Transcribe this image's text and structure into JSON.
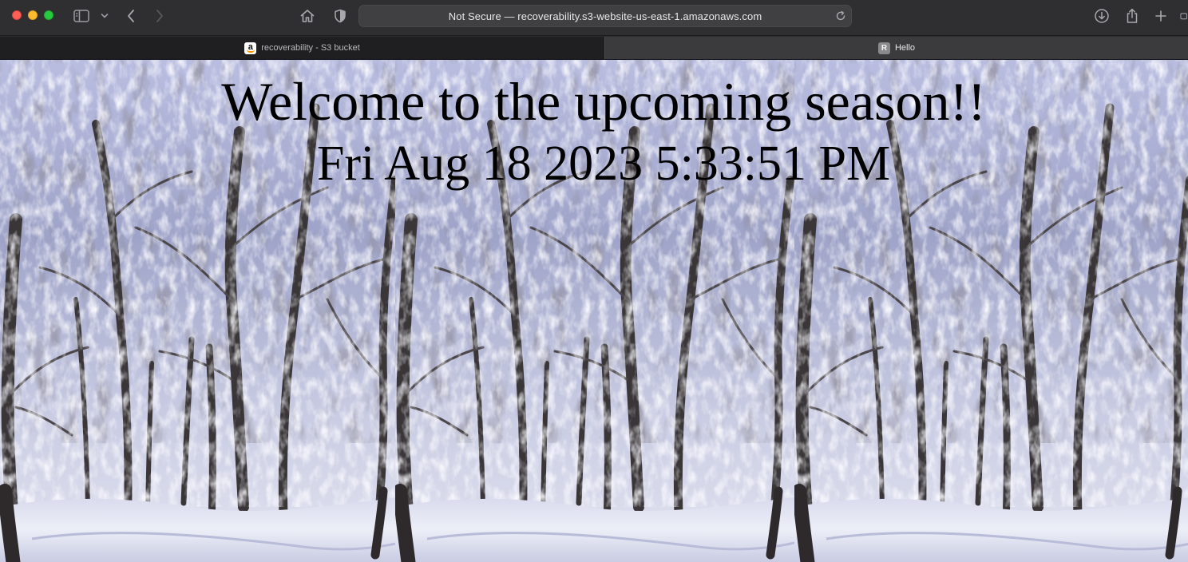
{
  "browser": {
    "address_text": "Not Secure — recoverability.s3-website-us-east-1.amazonaws.com",
    "tabs": [
      {
        "label": "recoverability - S3 bucket",
        "active": true,
        "favicon": "amazon-icon"
      },
      {
        "label": "Hello",
        "active": false,
        "favicon_letter": "R"
      }
    ],
    "icons": [
      "sidebar-icon",
      "chevron-down-icon",
      "back-icon",
      "forward-icon",
      "home-icon",
      "shield-icon",
      "reload-icon",
      "download-icon",
      "share-icon",
      "new-tab-icon",
      "tab-overview-icon"
    ]
  },
  "page": {
    "welcome": "Welcome to the upcoming season!!",
    "datetime": "Fri Aug 18 2023 5:33:51 PM",
    "background": "snowy forest (tiled)"
  },
  "colors": {
    "traffic_close": "#fe5f57",
    "traffic_min": "#febc2e",
    "traffic_max": "#28c840",
    "toolbar": "#2f2e31",
    "text": "#000000"
  }
}
